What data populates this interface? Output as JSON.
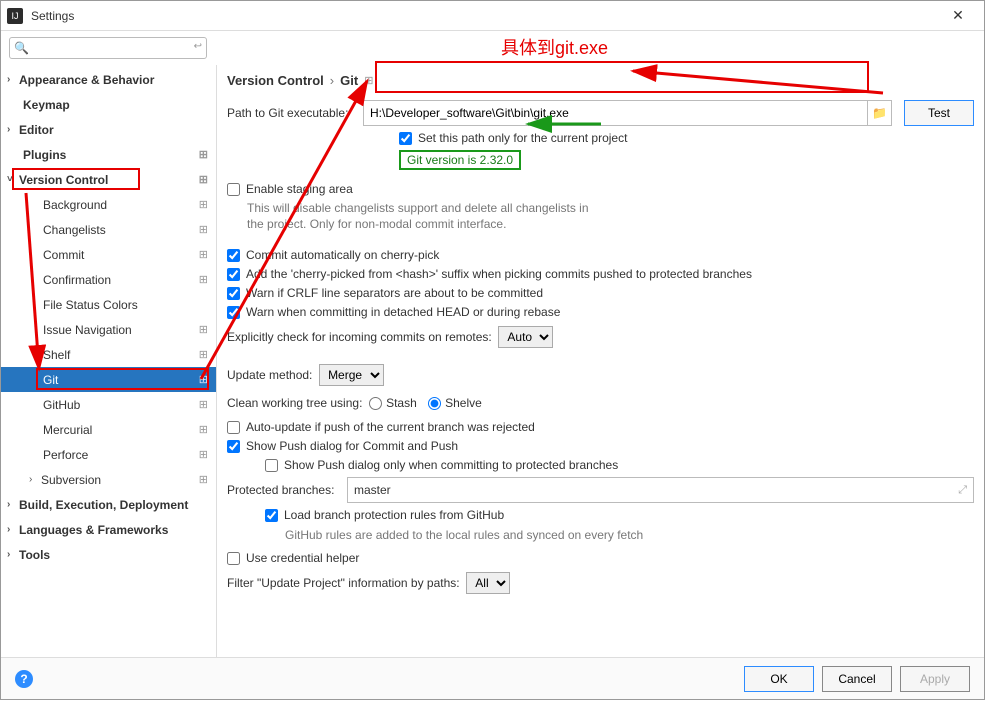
{
  "window": {
    "title": "Settings"
  },
  "search": {
    "placeholder": ""
  },
  "sidebar": {
    "items": [
      {
        "label": "Appearance & Behavior",
        "bold": true,
        "chev": ">",
        "indent": 0
      },
      {
        "label": "Keymap",
        "bold": true,
        "chev": "",
        "indent": 1
      },
      {
        "label": "Editor",
        "bold": true,
        "chev": ">",
        "indent": 0
      },
      {
        "label": "Plugins",
        "bold": true,
        "chev": "",
        "indent": 1,
        "badge": "⊞"
      },
      {
        "label": "Version Control",
        "bold": true,
        "chev": "˅",
        "indent": 0,
        "badge": "⊞"
      },
      {
        "label": "Background",
        "indent": 2,
        "badge": "⊞"
      },
      {
        "label": "Changelists",
        "indent": 2,
        "badge": "⊞"
      },
      {
        "label": "Commit",
        "indent": 2,
        "badge": "⊞"
      },
      {
        "label": "Confirmation",
        "indent": 2,
        "badge": "⊞"
      },
      {
        "label": "File Status Colors",
        "indent": 2
      },
      {
        "label": "Issue Navigation",
        "indent": 2,
        "badge": "⊞"
      },
      {
        "label": "Shelf",
        "indent": 2,
        "badge": "⊞"
      },
      {
        "label": "Git",
        "indent": 2,
        "badge": "⊞",
        "selected": true
      },
      {
        "label": "GitHub",
        "indent": 2,
        "badge": "⊞"
      },
      {
        "label": "Mercurial",
        "indent": 2,
        "badge": "⊞"
      },
      {
        "label": "Perforce",
        "indent": 2,
        "badge": "⊞"
      },
      {
        "label": "Subversion",
        "indent": 2,
        "chev": ">",
        "badge": "⊞"
      },
      {
        "label": "Build, Execution, Deployment",
        "bold": true,
        "chev": ">",
        "indent": 0
      },
      {
        "label": "Languages & Frameworks",
        "bold": true,
        "chev": ">",
        "indent": 0
      },
      {
        "label": "Tools",
        "bold": true,
        "chev": ">",
        "indent": 0
      }
    ]
  },
  "breadcrumb": {
    "a": "Version Control",
    "b": "Git",
    "badge": "⊞"
  },
  "annotation": {
    "title": "具体到git.exe"
  },
  "path": {
    "label": "Path to Git executable:",
    "value": "H:\\Developer_software\\Git\\bin\\git.exe",
    "test": "Test",
    "setOnly": "Set this path only for the current project",
    "version": "Git version is 2.32.0"
  },
  "staging": {
    "enable": "Enable staging area",
    "hint": "This will disable changelists support and delete all changelists in\nthe project. Only for non-modal commit interface."
  },
  "checks": {
    "c1": "Commit automatically on cherry-pick",
    "c2": "Add the 'cherry-picked from <hash>' suffix when picking commits pushed to protected branches",
    "c3": "Warn if CRLF line separators are about to be committed",
    "c4": "Warn when committing in detached HEAD or during rebase"
  },
  "incoming": {
    "label": "Explicitly check for incoming commits on remotes:",
    "value": "Auto"
  },
  "update": {
    "label": "Update method:",
    "value": "Merge"
  },
  "clean": {
    "label": "Clean working tree using:",
    "opt1": "Stash",
    "opt2": "Shelve"
  },
  "checks2": {
    "autoUpdate": "Auto-update if push of the current branch was rejected",
    "showPush": "Show Push dialog for Commit and Push",
    "showPushProtected": "Show Push dialog only when committing to protected branches"
  },
  "protected": {
    "label": "Protected branches:",
    "value": "master",
    "loadRules": "Load branch protection rules from GitHub",
    "hint": "GitHub rules are added to the local rules and synced on every fetch"
  },
  "cred": {
    "label": "Use credential helper"
  },
  "filter": {
    "label": "Filter \"Update Project\" information by paths:",
    "value": "All"
  },
  "footer": {
    "ok": "OK",
    "cancel": "Cancel",
    "apply": "Apply"
  }
}
